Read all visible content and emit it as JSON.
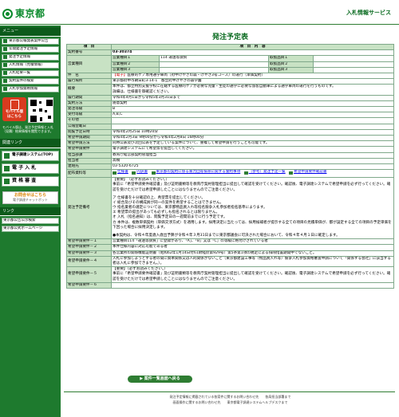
{
  "header": {
    "logo": "東京都",
    "service_title": "入札情報サービス"
  },
  "sidebar": {
    "menu_head": "メニュー",
    "items": [
      {
        "label": "東京都公報発表案件公告"
      },
      {
        "label": "年間発注予定情報"
      },
      {
        "label": "発注予定情報"
      },
      {
        "label": "入札情報（見積情報）"
      },
      {
        "label": "入札結果一覧"
      },
      {
        "label": "契約案件の検索"
      },
      {
        "label": "入札参加資格情報"
      }
    ],
    "mobile_label": "モバイル版",
    "mobile_sub": "はこちら",
    "mobile_note": "モバイル版は、発注予定情報と入札（見積）結果情報を閲覧できます。",
    "links_head": "関連リンク",
    "big_items": [
      {
        "label": "電子調達システム(TOP)"
      },
      {
        "label": "電 子 入 札"
      },
      {
        "label": "資 格 審 査"
      }
    ],
    "help_title": "お問合せはこちら",
    "help_sub": "電子調達チャットボット",
    "info_head": "リンク",
    "info_items": [
      {
        "label": "東京都公告公示検索"
      },
      {
        "label": "東京都公式ホームページ"
      }
    ]
  },
  "main": {
    "title": "発注予定表",
    "head": {
      "col1": "項　目",
      "col2": "項　目　内　容"
    },
    "contract_no": {
      "label": "契約番号",
      "value": "03-30374"
    },
    "type_rows": [
      {
        "sub": "営業種目１",
        "subv": "114 運送等請負",
        "sub2": "取扱品目１",
        "sub2v": ""
      },
      {
        "sub": "営業種目２",
        "subv": "",
        "sub2": "取扱品目２",
        "sub2v": ""
      },
      {
        "sub": "営業種目３",
        "subv": "",
        "sub2": "取扱品目３",
        "sub2v": ""
      }
    ],
    "type_label": "営業種目",
    "item": {
      "label": "件　名",
      "tag": "【電子】",
      "value": "医療的ケア専用通学車両（府中けやきの森・けやき3号コース）の運行（単価契約）"
    },
    "place": {
      "label": "履行場所",
      "value": "東京都府中市朝日町3-14-1　都立府中けやきの森学園"
    },
    "summary": {
      "label": "概要",
      "value": "本件は、都立特別支援学校に在籍する医療的ケアが必要な児童・生徒の通学に必要な旅客自動車による通学車両の運行を行うものです。",
      "value2": "詳細は、仕様書を御確認ください。"
    },
    "period": {
      "label": "履行期間",
      "value": "令和4年4月1日から令和5年3月31日まで"
    },
    "method": {
      "label": "契約方法",
      "value": "随意契約"
    },
    "grade": {
      "label": "発注等級",
      "value": "B"
    },
    "grade2": {
      "label": "受付等級",
      "value": "A,B,C"
    },
    "other": {
      "label": "その他",
      "value": ""
    },
    "notice_date": {
      "label": "公報登載日",
      "value": ""
    },
    "open_date": {
      "label": "閲覧予定日時",
      "value": "令和4年2月25日 10時20分"
    },
    "apply_period": {
      "label": "希望申請期間",
      "value": "令和4年2月3日 9時00分から令和4年2月8日 16時00分"
    },
    "apply_method": {
      "label": "希望申請方法",
      "value": "同時公表及び次回公表を予定している案件について、重複して希望申請を行うことも可能です。"
    },
    "apply_req": {
      "label": "希望申請要件",
      "value": "電子調達システムにて希望票を提出してください。"
    },
    "dept": {
      "label": "担当部課",
      "value": "教育庁経営部契約管理担当"
    },
    "person": {
      "label": "担当者",
      "value": "高橋"
    },
    "contact": {
      "label": "連絡先",
      "value": "03-5320-6725"
    },
    "files": {
      "label": "配布資料等",
      "items": [
        {
          "name": "仕様書"
        },
        {
          "name": "内訳書"
        },
        {
          "name": "東京都の契約に係る暴力団等排除に関する誓約事項"
        },
        {
          "name": "（参考）発注予定一覧"
        },
        {
          "name": "希望申請要件確認書"
        }
      ]
    },
    "notes": {
      "label": "発注予定備考",
      "lines": [
        "【重要】　（必ずお読みください。）",
        "事前に「希望申請要件確認書」及び証明書類等を教育庁契約管理担当に提出して確認を受けてください。確認後、電子調達システムで希望申請を必ず行ってください。確認を受けただけでは希望申請したことにはなりませんのでご注意ください。",
        "ア 仕様書を十分確認の上、希望票を提出してください。",
        "イ 総合及びその構成員が同一の案件を希望することはできません。",
        "ウ 指名業者の選定については、東京都物品買入れ等指名競争入札参加者指名基準によります。",
        "エ 希望票の提出があっても必ずしも指名されるとは限りません。",
        "オ 入札（指名通知）は、閲覧予定日の一週間前までに行う予定です。",
        "カ 本件は、複数単価契約（単価交渉方式）を適用します。採用決定に当たっては、採用候補者が提示する全ての項目の見積単価が、都が設定する全ての項目の予定単価を下回った場合に採用決定します。",
        "●本契約は、令和４年度歳入歳出予算が令和４年３月31日までに東京都議会に可決された場合において、令和４年４月１日に確定します。"
      ]
    },
    "req_rows": [
      {
        "label": "希望申請要件－１",
        "value": "営業種目114「運送等請負」に登録があり、「A」、「B」又は「C」の等級に格付けされている者"
      },
      {
        "label": "希望申請要件－２",
        "value": "本件仕様内容に対応可能である者"
      },
      {
        "label": "希望申請要件－３",
        "value": "各営業所の関係機能証明書（昭和62年1月14日付61財経庶第929号）第5条第1項の規定による排除措置期間中でないこと。"
      },
      {
        "label": "希望申請要件－４",
        "value": "入札に参加しようとする者の間に資本関係又は人的関係がないこと（東京都建設工事等（物品買入れ等）競争入札参加資格審査申請について「関係する会社」に該当する者は入札に参加できません。）。"
      },
      {
        "label": "希望申請要件－５",
        "value": "【重要】（必ずお読みください。）",
        "value2": "事前に「希望申請要件確認書」及び証明書類等を教育庁契約管理担当に提出して確認を受けてください。確認後、電子調達システムで希望申請を必ず行ってください。確認を受けただけでは希望申請したことにはなりませんのでご注意ください。"
      },
      {
        "label": "希望申請要件－６",
        "value": ""
      }
    ]
  },
  "back_button": "▶ 案件一覧画面へ戻る",
  "footer": {
    "line1": "発注予定情報に掲載されている各案件に関するお問い合わせ先　　各局担当部署まで",
    "line2": "画面操作に関するお問い合わせ先　　東京都電子調達システムヘルプデスクまで"
  }
}
